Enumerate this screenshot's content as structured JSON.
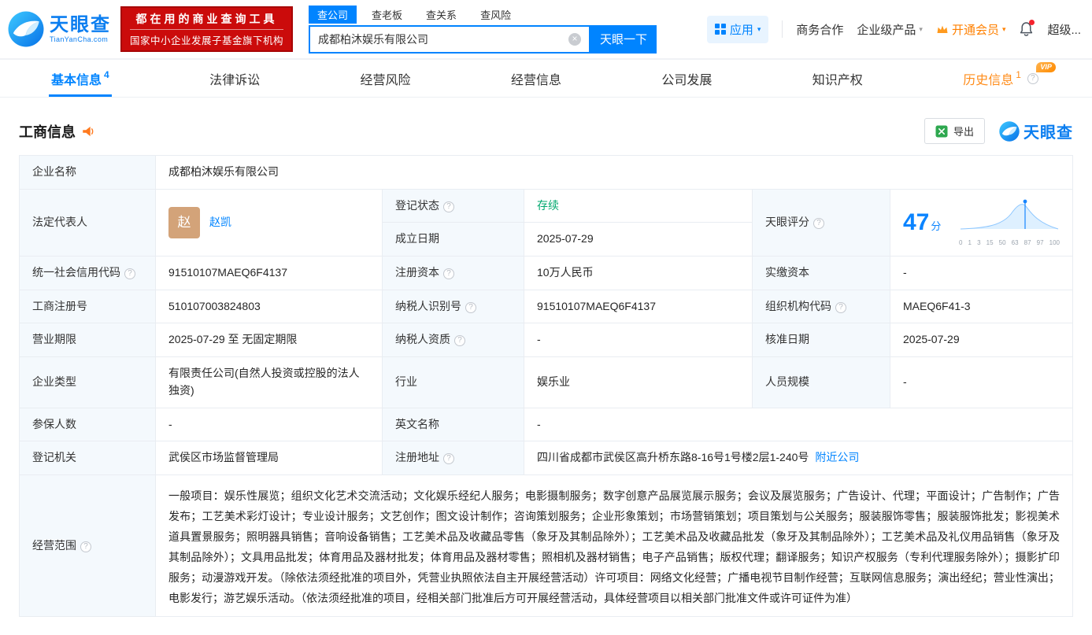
{
  "colors": {
    "accent": "#0084ff",
    "vip_orange": "#ff8c1a",
    "status_green": "#00a86e",
    "banner_red": "#cb0b0b",
    "label_bg": "#f4f9fd"
  },
  "icons": {
    "caret": "▾",
    "clear": "×",
    "help": "?"
  },
  "header": {
    "logo_text": "天眼查",
    "logo_sub": "TianYanCha.com",
    "banner_line1": "都在用的商业查询工具",
    "banner_line2": "国家中小企业发展子基金旗下机构",
    "search_tabs": [
      "查公司",
      "查老板",
      "查关系",
      "查风险"
    ],
    "search_value": "成都柏沐娱乐有限公司",
    "search_button": "天眼一下",
    "app_label": "应用",
    "nav_items": [
      "商务合作",
      "企业级产品",
      "开通会员",
      "超级..."
    ]
  },
  "page_tabs": [
    {
      "label": "基本信息",
      "badge": "4"
    },
    {
      "label": "法律诉讼"
    },
    {
      "label": "经营风险"
    },
    {
      "label": "经营信息"
    },
    {
      "label": "公司发展"
    },
    {
      "label": "知识产权"
    },
    {
      "label": "历史信息",
      "badge": "1",
      "vip": "VIP"
    }
  ],
  "section": {
    "title": "工商信息",
    "export_label": "导出",
    "logo_text": "天眼查"
  },
  "fields": {
    "company_name_label": "企业名称",
    "company_name": "成都柏沐娱乐有限公司",
    "legal_rep_label": "法定代表人",
    "legal_rep_avatar": "赵",
    "legal_rep_name": "赵凯",
    "reg_status_label": "登记状态",
    "reg_status": "存续",
    "established_label": "成立日期",
    "established": "2025-07-29",
    "score_label": "天眼评分",
    "score_value": "47",
    "score_unit": "分",
    "score_axis": [
      "0",
      "1",
      "3",
      "15",
      "50",
      "63",
      "87",
      "97",
      "100"
    ],
    "credit_code_label": "统一社会信用代码",
    "credit_code": "91510107MAEQ6F4137",
    "reg_capital_label": "注册资本",
    "reg_capital": "10万人民币",
    "paid_capital_label": "实缴资本",
    "paid_capital": "-",
    "reg_number_label": "工商注册号",
    "reg_number": "510107003824803",
    "taxpayer_id_label": "纳税人识别号",
    "taxpayer_id": "91510107MAEQ6F4137",
    "org_code_label": "组织机构代码",
    "org_code": "MAEQ6F41-3",
    "business_term_label": "营业期限",
    "business_term": "2025-07-29 至 无固定期限",
    "taxpayer_qual_label": "纳税人资质",
    "taxpayer_qual": "-",
    "approval_date_label": "核准日期",
    "approval_date": "2025-07-29",
    "company_type_label": "企业类型",
    "company_type": "有限责任公司(自然人投资或控股的法人独资)",
    "industry_label": "行业",
    "industry": "娱乐业",
    "staff_size_label": "人员规模",
    "staff_size": "-",
    "insured_label": "参保人数",
    "insured": "-",
    "english_name_label": "英文名称",
    "english_name": "-",
    "reg_authority_label": "登记机关",
    "reg_authority": "武侯区市场监督管理局",
    "reg_address_label": "注册地址",
    "reg_address": "四川省成都市武侯区高升桥东路8-16号1号楼2层1-240号",
    "nearby_link": "附近公司",
    "business_scope_label": "经营范围",
    "business_scope": "一般项目：娱乐性展览；组织文化艺术交流活动；文化娱乐经纪人服务；电影摄制服务；数字创意产品展览展示服务；会议及展览服务；广告设计、代理；平面设计；广告制作；广告发布；工艺美术彩灯设计；专业设计服务；文艺创作；图文设计制作；咨询策划服务；企业形象策划；市场营销策划；项目策划与公关服务；服装服饰零售；服装服饰批发；影视美术道具置景服务；照明器具销售；音响设备销售；工艺美术品及收藏品零售（象牙及其制品除外）；工艺美术品及收藏品批发（象牙及其制品除外）；工艺美术品及礼仪用品销售（象牙及其制品除外）；文具用品批发；体育用品及器材批发；体育用品及器材零售；照相机及器材销售；电子产品销售；版权代理；翻译服务；知识产权服务（专利代理服务除外）；摄影扩印服务；动漫游戏开发。（除依法须经批准的项目外，凭营业执照依法自主开展经营活动）许可项目：网络文化经营；广播电视节目制作经营；互联网信息服务；演出经纪；营业性演出；电影发行；游艺娱乐活动。（依法须经批准的项目，经相关部门批准后方可开展经营活动，具体经营项目以相关部门批准文件或许可证件为准）"
  }
}
